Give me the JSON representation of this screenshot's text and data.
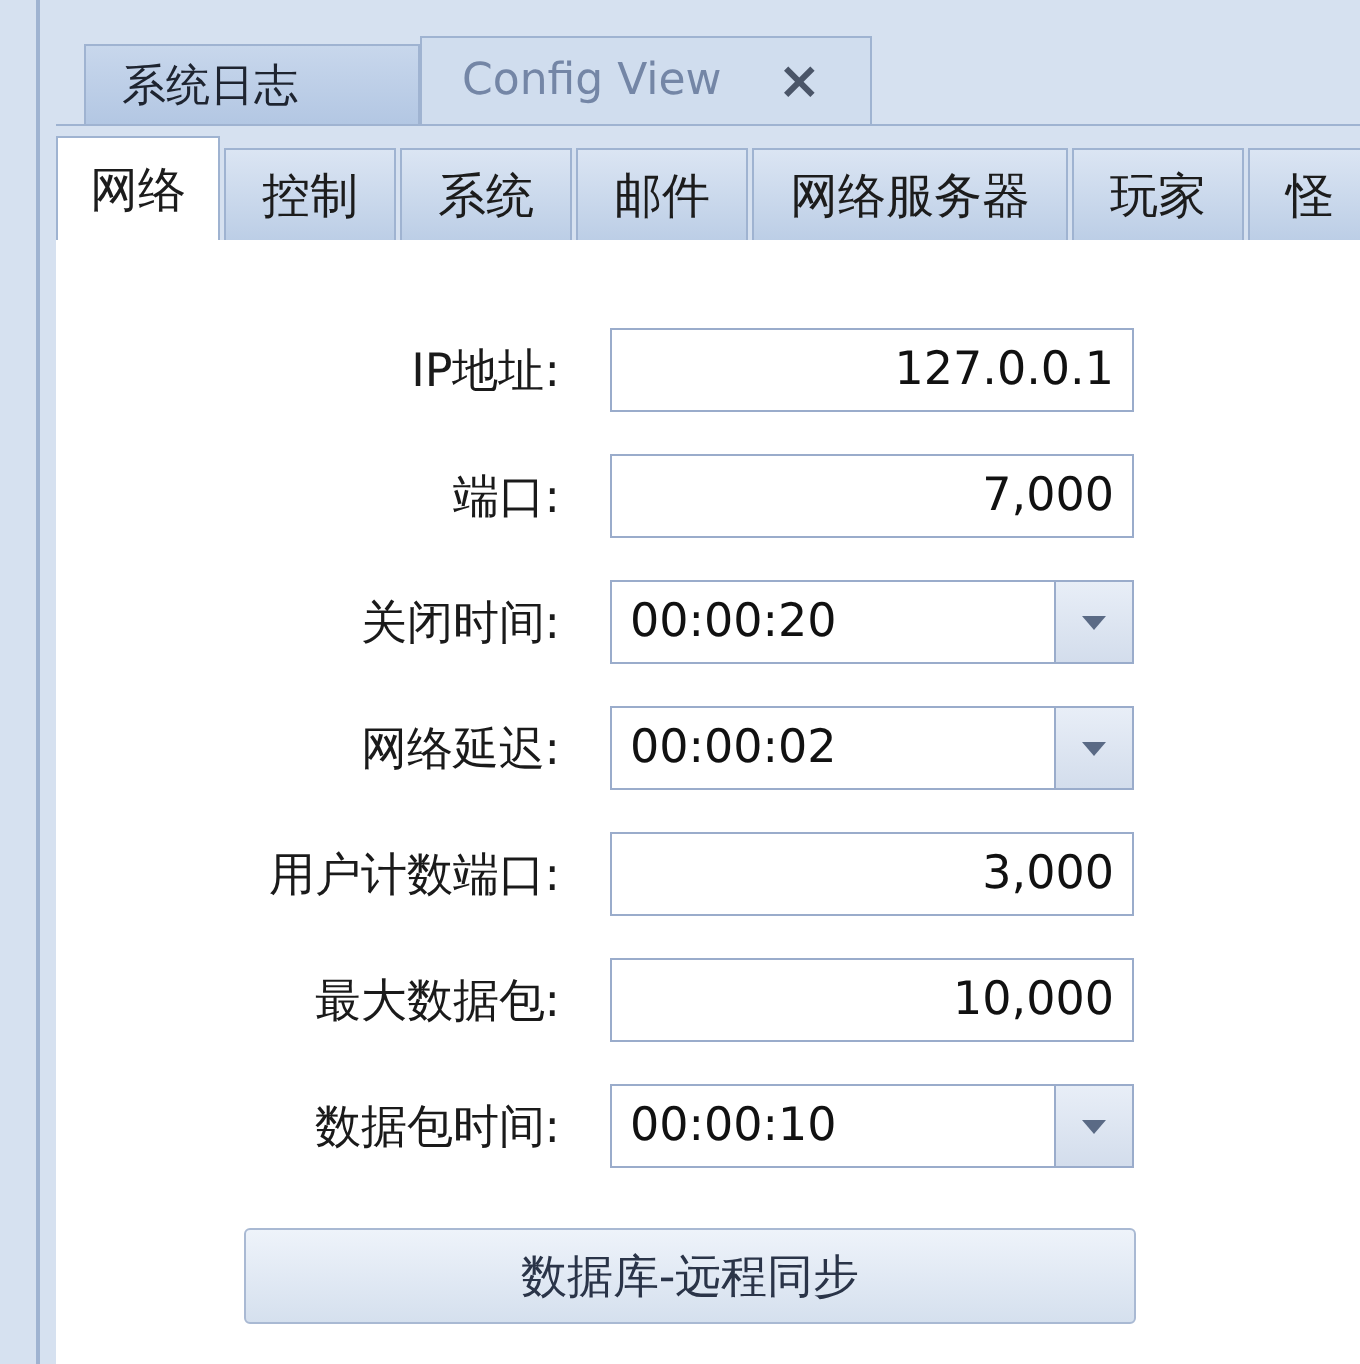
{
  "document_tabs": [
    {
      "label": "系统日志",
      "selected": false
    },
    {
      "label": "Config View",
      "selected": true,
      "close_glyph": "×"
    }
  ],
  "tabs": [
    {
      "label": "网络",
      "selected": true
    },
    {
      "label": "控制",
      "selected": false
    },
    {
      "label": "系统",
      "selected": false
    },
    {
      "label": "邮件",
      "selected": false
    },
    {
      "label": "网络服务器",
      "selected": false
    },
    {
      "label": "玩家",
      "selected": false
    },
    {
      "label": "怪",
      "selected": false
    }
  ],
  "fields": [
    {
      "label": "IP地址:",
      "kind": "text",
      "value": "127.0.0.1"
    },
    {
      "label": "端口:",
      "kind": "text",
      "value": "7,000"
    },
    {
      "label": "关闭时间:",
      "kind": "dropdown",
      "value": "00:00:20"
    },
    {
      "label": "网络延迟:",
      "kind": "dropdown",
      "value": "00:00:02"
    },
    {
      "label": "用户计数端口:",
      "kind": "text",
      "value": "3,000"
    },
    {
      "label": "最大数据包:",
      "kind": "text",
      "value": "10,000"
    },
    {
      "label": "数据包时间:",
      "kind": "dropdown",
      "value": "00:00:10"
    }
  ],
  "button": "数据库-远程同步"
}
